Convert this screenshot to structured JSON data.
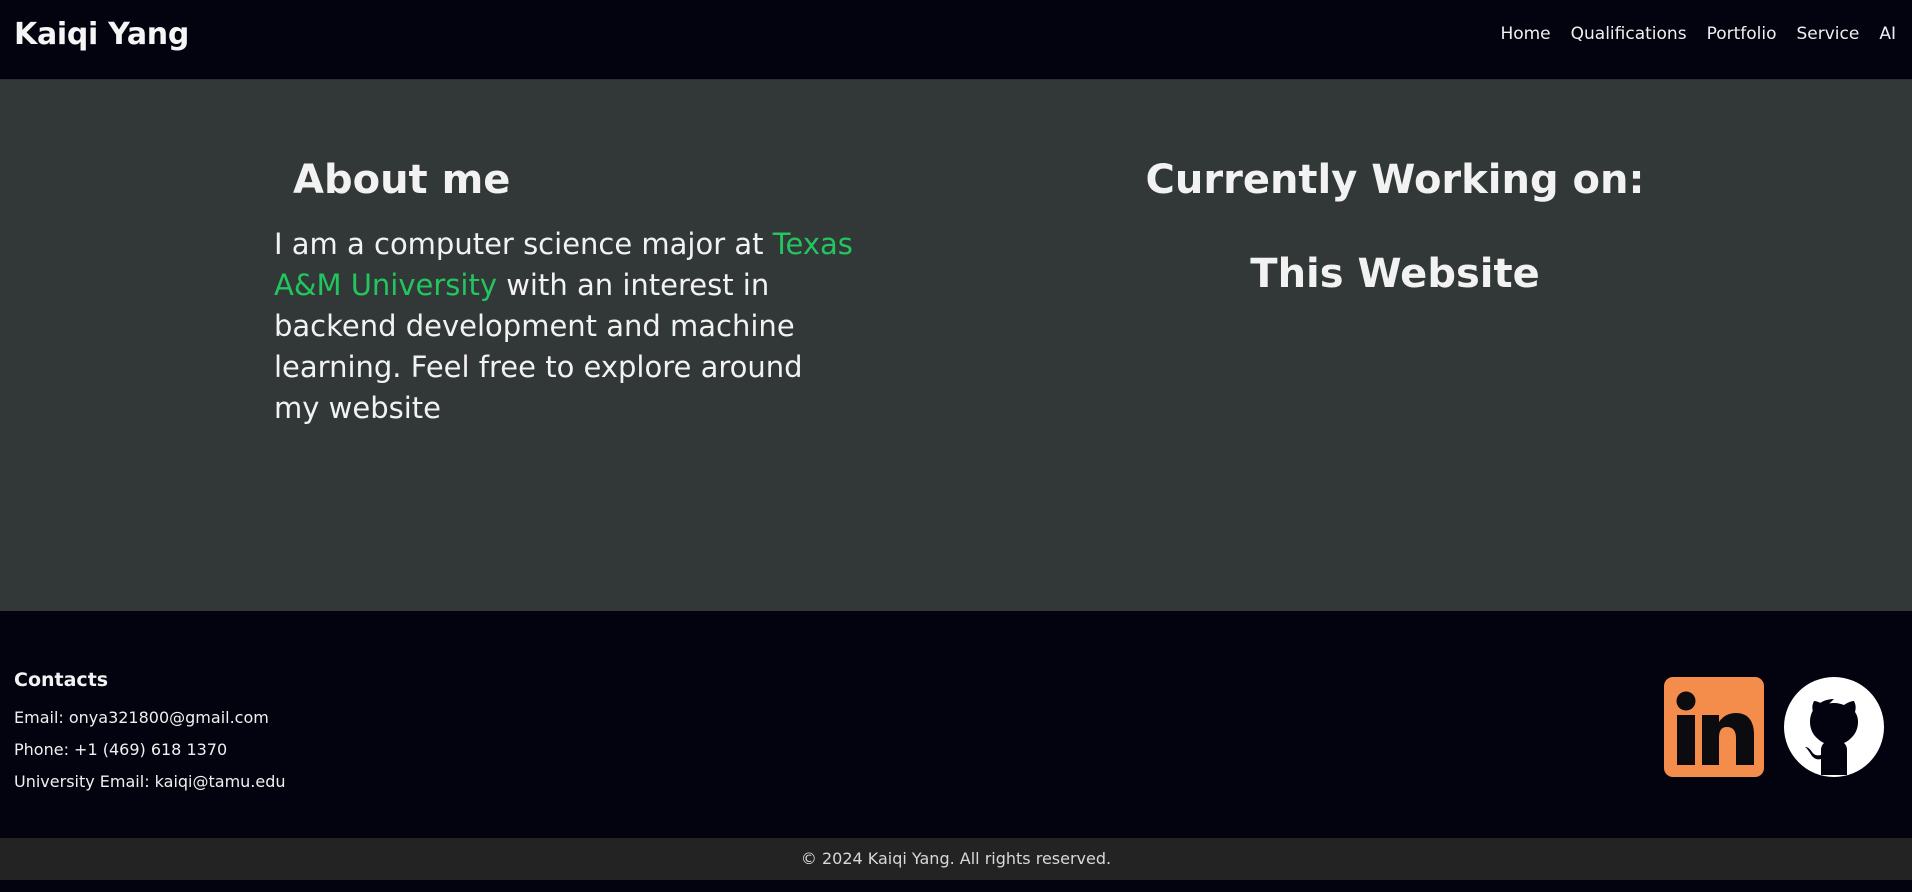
{
  "header": {
    "brand": "Kaiqi Yang",
    "nav": [
      {
        "label": "Home"
      },
      {
        "label": "Qualifications"
      },
      {
        "label": "Portfolio"
      },
      {
        "label": "Service"
      },
      {
        "label": "AI"
      }
    ]
  },
  "about": {
    "title": "About me",
    "text_before": "I am a computer science major at ",
    "link_text": "Texas A&M University",
    "text_after": " with an interest in backend development and machine learning. Feel free to explore around my website"
  },
  "working": {
    "title": "Currently Working on:",
    "item": "This Website"
  },
  "footer": {
    "contacts_title": "Contacts",
    "email": "Email: onya321800@gmail.com",
    "phone": "Phone: +1 (469) 618 1370",
    "university_email": "University Email: kaiqi@tamu.edu",
    "icons": {
      "linkedin": "linkedin-icon",
      "github": "github-icon"
    }
  },
  "copyright": "© 2024 Kaiqi Yang. All rights reserved.",
  "colors": {
    "header_bg": "#02030f",
    "main_bg": "#323837",
    "accent_green": "#22c55e",
    "linkedin_orange": "#f48c4b",
    "copyright_bg": "#232323"
  }
}
